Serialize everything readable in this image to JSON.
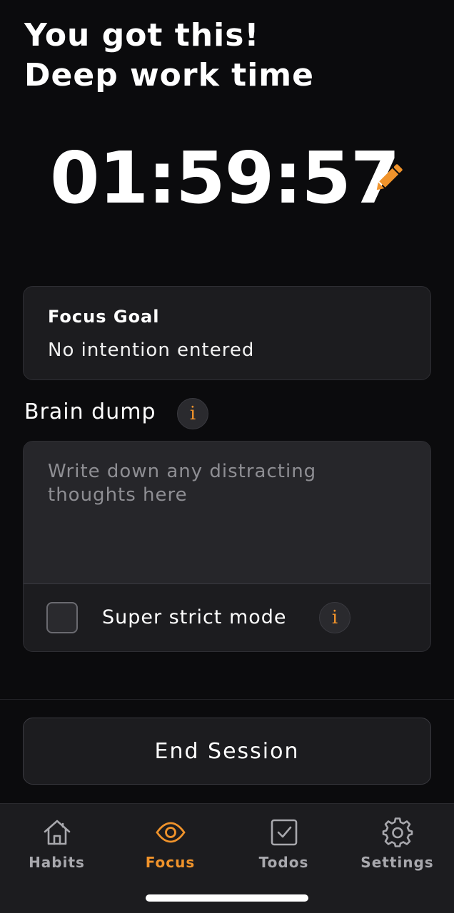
{
  "header": {
    "line1": "You got this!",
    "line2": "Deep work time"
  },
  "timer": {
    "display": "01:59:57",
    "edit_icon": "pencil-icon"
  },
  "focus_goal": {
    "title": "Focus Goal",
    "value": "No intention entered"
  },
  "brain_dump": {
    "label": "Brain dump",
    "info_icon": "info-icon",
    "placeholder": "Write down any distracting thoughts here",
    "value": ""
  },
  "strict_mode": {
    "label": "Super strict mode",
    "checked": false,
    "info_icon": "info-icon"
  },
  "end_session": {
    "label": "End Session"
  },
  "tabs": [
    {
      "label": "Habits",
      "icon": "home-icon",
      "active": false
    },
    {
      "label": "Focus",
      "icon": "eye-icon",
      "active": true
    },
    {
      "label": "Todos",
      "icon": "checkbox-icon",
      "active": false
    },
    {
      "label": "Settings",
      "icon": "gear-icon",
      "active": false
    }
  ],
  "colors": {
    "accent": "#f0932b",
    "background": "#0b0b0d",
    "card": "#1c1c1f",
    "inactive_tab": "#a8a8ad"
  }
}
